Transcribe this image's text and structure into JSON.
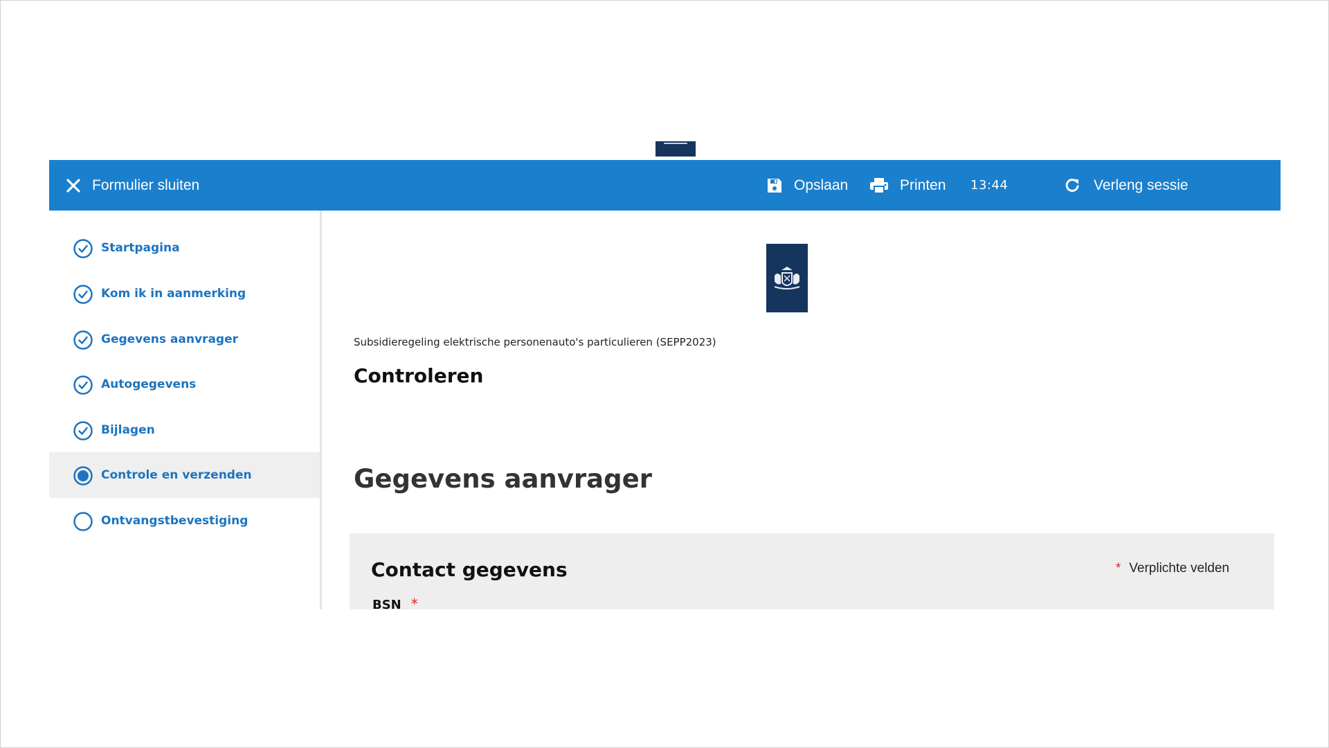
{
  "toolbar": {
    "close_label": "Formulier sluiten",
    "save_label": "Opslaan",
    "print_label": "Printen",
    "session_time": "13:44",
    "extend_label": "Verleng sessie"
  },
  "steps": [
    {
      "label": "Startpagina",
      "state": "completed"
    },
    {
      "label": "Kom ik in aanmerking",
      "state": "completed"
    },
    {
      "label": "Gegevens aanvrager",
      "state": "completed"
    },
    {
      "label": "Autogegevens",
      "state": "completed"
    },
    {
      "label": "Bijlagen",
      "state": "completed"
    },
    {
      "label": "Controle en verzenden",
      "state": "active"
    },
    {
      "label": "Ontvangstbevestiging",
      "state": "todo"
    }
  ],
  "main": {
    "subtitle": "Subsidieregeling elektrische personenauto's particulieren (SEPP2023)",
    "page_title": "Controleren",
    "section_title": "Gegevens aanvrager",
    "panel": {
      "title": "Contact gegevens",
      "required_marker": "*",
      "required_note": "Verplichte velden",
      "field_label": "BSN",
      "field_marker": "*"
    }
  },
  "colors": {
    "toolbar": "#1a7fcc",
    "link": "#1c74c0",
    "logo": "#15355e",
    "required": "#d52b1e"
  }
}
